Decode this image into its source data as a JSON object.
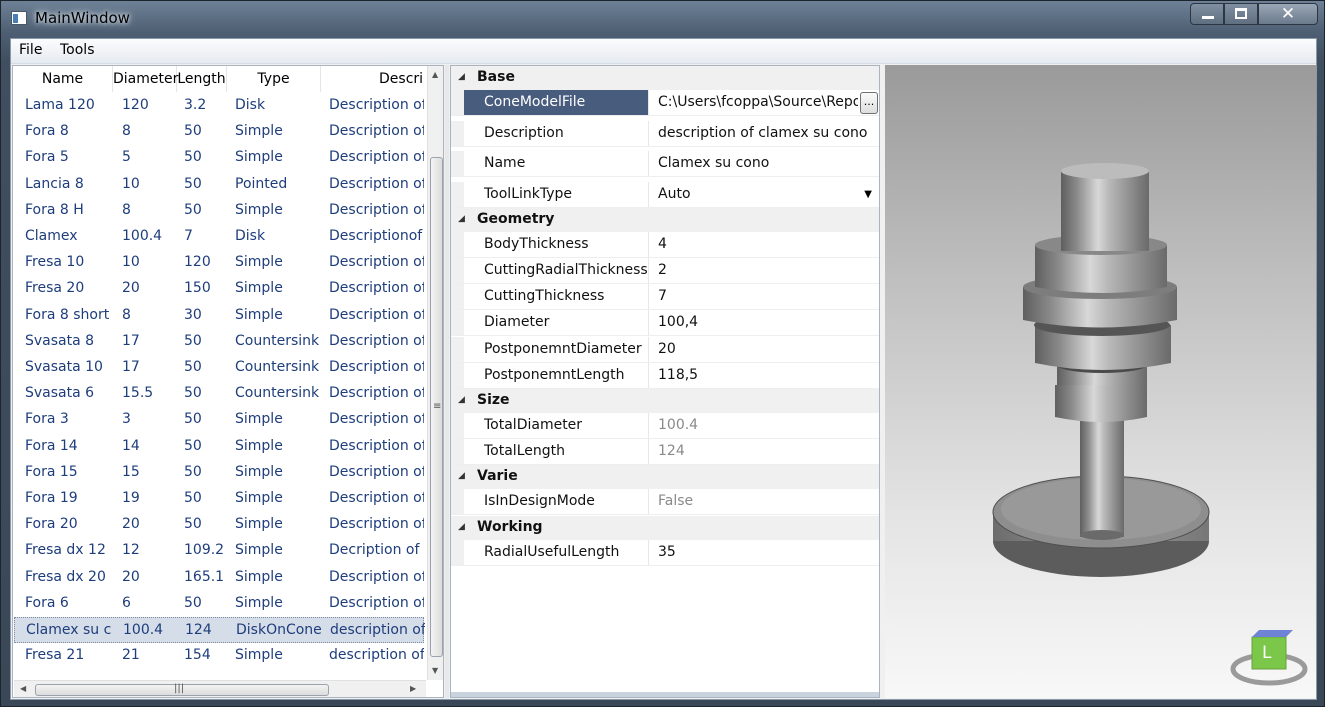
{
  "window": {
    "title": "MainWindow"
  },
  "menu": {
    "file": "File",
    "tools": "Tools"
  },
  "list": {
    "columns": [
      "Name",
      "Diameter",
      "Length",
      "Type",
      "Descri"
    ],
    "rows": [
      {
        "name": "Lama 120",
        "diameter": "120",
        "length": "3.2",
        "type": "Disk",
        "description": "Description of"
      },
      {
        "name": "Fora 8",
        "diameter": "8",
        "length": "50",
        "type": "Simple",
        "description": "Description of"
      },
      {
        "name": "Fora 5",
        "diameter": "5",
        "length": "50",
        "type": "Simple",
        "description": "Description of"
      },
      {
        "name": "Lancia 8",
        "diameter": "10",
        "length": "50",
        "type": "Pointed",
        "description": "Description of"
      },
      {
        "name": "Fora 8 H",
        "diameter": "8",
        "length": "50",
        "type": "Simple",
        "description": "Description of"
      },
      {
        "name": "Clamex",
        "diameter": "100.4",
        "length": "7",
        "type": "Disk",
        "description": "Descriptionof"
      },
      {
        "name": "Fresa 10",
        "diameter": "10",
        "length": "120",
        "type": "Simple",
        "description": "Description of"
      },
      {
        "name": "Fresa 20",
        "diameter": "20",
        "length": "150",
        "type": "Simple",
        "description": "Description of"
      },
      {
        "name": "Fora 8 short",
        "diameter": "8",
        "length": "30",
        "type": "Simple",
        "description": "Description of"
      },
      {
        "name": "Svasata 8",
        "diameter": "17",
        "length": "50",
        "type": "Countersink",
        "description": "Description of"
      },
      {
        "name": "Svasata 10",
        "diameter": "17",
        "length": "50",
        "type": "Countersink",
        "description": "Description of"
      },
      {
        "name": "Svasata 6",
        "diameter": "15.5",
        "length": "50",
        "type": "Countersink",
        "description": "Description of"
      },
      {
        "name": "Fora 3",
        "diameter": "3",
        "length": "50",
        "type": "Simple",
        "description": "Description of"
      },
      {
        "name": "Fora 14",
        "diameter": "14",
        "length": "50",
        "type": "Simple",
        "description": "Description of"
      },
      {
        "name": "Fora 15",
        "diameter": "15",
        "length": "50",
        "type": "Simple",
        "description": "Description of"
      },
      {
        "name": "Fora 19",
        "diameter": "19",
        "length": "50",
        "type": "Simple",
        "description": "Description of"
      },
      {
        "name": "Fora 20",
        "diameter": "20",
        "length": "50",
        "type": "Simple",
        "description": "Description of"
      },
      {
        "name": "Fresa dx 12",
        "diameter": "12",
        "length": "109.2",
        "type": "Simple",
        "description": "Decription of t"
      },
      {
        "name": "Fresa dx 20",
        "diameter": "20",
        "length": "165.1",
        "type": "Simple",
        "description": "Description of"
      },
      {
        "name": "Fora 6",
        "diameter": "6",
        "length": "50",
        "type": "Simple",
        "description": "Description of"
      },
      {
        "name": "Clamex su c",
        "diameter": "100.4",
        "length": "124",
        "type": "DiskOnCone",
        "description": "description of"
      },
      {
        "name": "Fresa 21",
        "diameter": "21",
        "length": "154",
        "type": "Simple",
        "description": "description of"
      }
    ]
  },
  "props": {
    "categories": [
      "Base",
      "Geometry",
      "Size",
      "Varie",
      "Working"
    ],
    "base": [
      {
        "name": "ConeModelFile",
        "value": "C:\\Users\\fcoppa\\Source\\Repos"
      },
      {
        "name": "Description",
        "value": "description of clamex su cono"
      },
      {
        "name": "Name",
        "value": "Clamex su cono"
      },
      {
        "name": "ToolLinkType",
        "value": "Auto"
      }
    ],
    "geometry": [
      {
        "name": "BodyThickness",
        "value": "4"
      },
      {
        "name": "CuttingRadialThickness",
        "value": "2"
      },
      {
        "name": "CuttingThickness",
        "value": "7"
      },
      {
        "name": "Diameter",
        "value": "100,4"
      },
      {
        "name": "PostponemntDiameter",
        "value": "20"
      },
      {
        "name": "PostponemntLength",
        "value": "118,5"
      }
    ],
    "size": [
      {
        "name": "TotalDiameter",
        "value": "100.4"
      },
      {
        "name": "TotalLength",
        "value": "124"
      }
    ],
    "varie": [
      {
        "name": "IsInDesignMode",
        "value": "False"
      }
    ],
    "working": [
      {
        "name": "RadialUsefulLength",
        "value": "35"
      }
    ],
    "ellipsis": "...",
    "viewcube_label": "L"
  }
}
